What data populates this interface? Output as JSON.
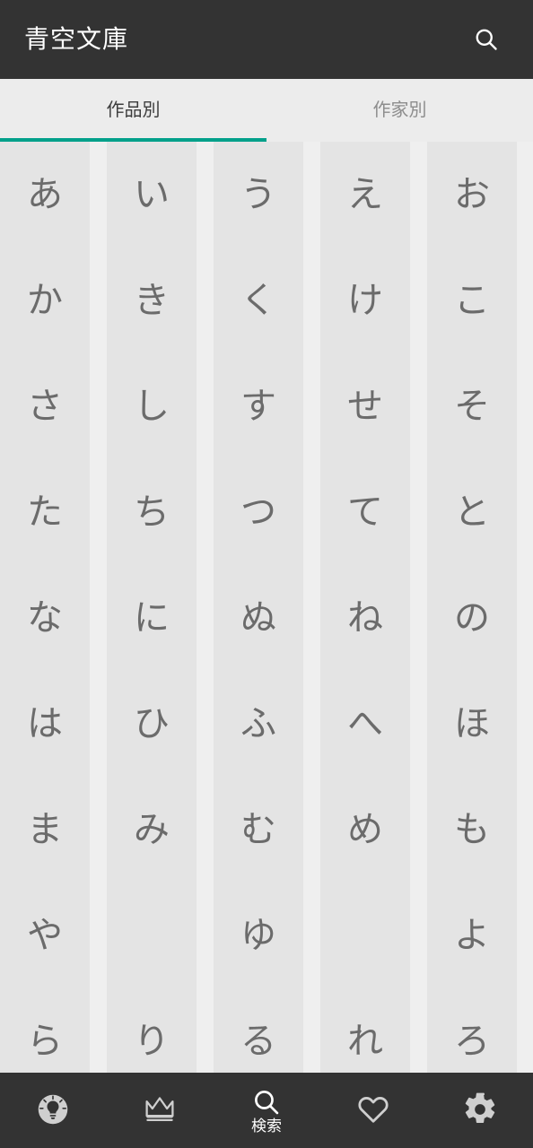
{
  "app": {
    "title": "青空文庫",
    "accent_color": "#00a08a",
    "appbar_bg": "#333333",
    "tabbar_bg": "#ececec",
    "column_bg": "#e4e4e4",
    "page_bg": "#efefef",
    "kana_color": "#6b6b6b"
  },
  "appbar": {
    "title": "青空文庫",
    "search_icon": "search-icon"
  },
  "tabs": [
    {
      "label": "作品別",
      "active": true
    },
    {
      "label": "作家別",
      "active": false
    }
  ],
  "kana_grid": {
    "columns": [
      {
        "index": 0,
        "cells": [
          "あ",
          "か",
          "さ",
          "た",
          "な",
          "は",
          "ま",
          "や",
          "ら"
        ]
      },
      {
        "index": 1,
        "cells": [
          "い",
          "き",
          "し",
          "ち",
          "に",
          "ひ",
          "み",
          "",
          "り"
        ]
      },
      {
        "index": 2,
        "cells": [
          "う",
          "く",
          "す",
          "つ",
          "ぬ",
          "ふ",
          "む",
          "ゆ",
          "る"
        ]
      },
      {
        "index": 3,
        "cells": [
          "え",
          "け",
          "せ",
          "て",
          "ね",
          "へ",
          "め",
          "",
          "れ"
        ]
      },
      {
        "index": 4,
        "cells": [
          "お",
          "こ",
          "そ",
          "と",
          "の",
          "ほ",
          "も",
          "よ",
          "ろ"
        ]
      }
    ]
  },
  "bottom_nav": [
    {
      "icon": "lightbulb-icon",
      "label": "",
      "active": false
    },
    {
      "icon": "crown-icon",
      "label": "",
      "active": false
    },
    {
      "icon": "search-icon",
      "label": "検索",
      "active": true
    },
    {
      "icon": "heart-icon",
      "label": "",
      "active": false
    },
    {
      "icon": "gear-icon",
      "label": "",
      "active": false
    }
  ]
}
